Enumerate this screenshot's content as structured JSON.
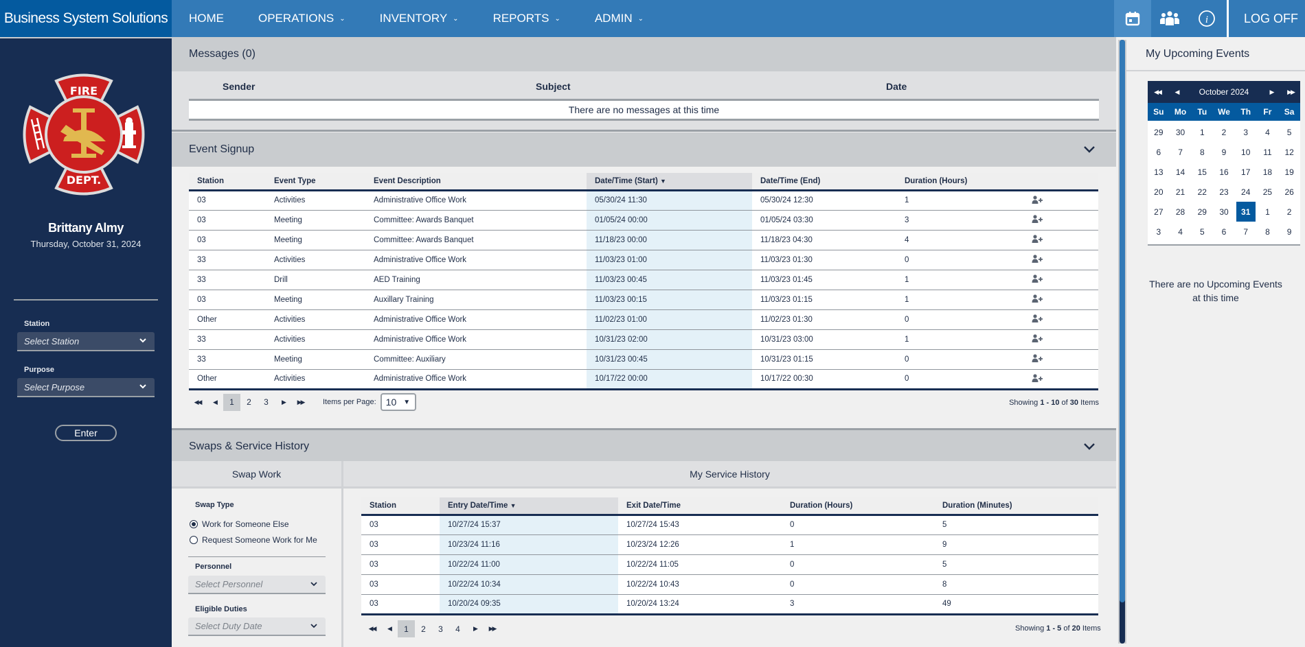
{
  "header": {
    "brand": "Business System Solutions",
    "nav": [
      {
        "label": "HOME",
        "dropdown": false
      },
      {
        "label": "OPERATIONS",
        "dropdown": true
      },
      {
        "label": "INVENTORY",
        "dropdown": true
      },
      {
        "label": "REPORTS",
        "dropdown": true
      },
      {
        "label": "ADMIN",
        "dropdown": true
      }
    ],
    "icons": [
      "calendar-icon",
      "group-icon",
      "info-icon"
    ],
    "logoff_label": "LOG OFF"
  },
  "sidebar": {
    "logo_top_text": "FIRE",
    "logo_bottom_text": "DEPT.",
    "user_name": "Brittany Almy",
    "date": "Thursday, October 31, 2024",
    "station_label": "Station",
    "station_placeholder": "Select Station",
    "purpose_label": "Purpose",
    "purpose_placeholder": "Select Purpose",
    "enter_label": "Enter"
  },
  "messages": {
    "title": "Messages (0)",
    "columns": [
      "Sender",
      "Subject",
      "Date"
    ],
    "empty_text": "There are no messages at this time"
  },
  "event_signup": {
    "title": "Event Signup",
    "columns": [
      "Station",
      "Event Type",
      "Event Description",
      "Date/Time (Start)",
      "Date/Time (End)",
      "Duration (Hours)"
    ],
    "sort_indicator": "▼",
    "rows": [
      {
        "station": "03",
        "type": "Activities",
        "description": "Administrative Office Work",
        "start": "05/30/24 11:30",
        "end": "05/30/24 12:30",
        "duration": "1"
      },
      {
        "station": "03",
        "type": "Meeting",
        "description": "Committee: Awards Banquet",
        "start": "01/05/24 00:00",
        "end": "01/05/24 03:30",
        "duration": "3"
      },
      {
        "station": "03",
        "type": "Meeting",
        "description": "Committee: Awards Banquet",
        "start": "11/18/23 00:00",
        "end": "11/18/23 04:30",
        "duration": "4"
      },
      {
        "station": "33",
        "type": "Activities",
        "description": "Administrative Office Work",
        "start": "11/03/23 01:00",
        "end": "11/03/23 01:30",
        "duration": "0"
      },
      {
        "station": "33",
        "type": "Drill",
        "description": "AED Training",
        "start": "11/03/23 00:45",
        "end": "11/03/23 01:45",
        "duration": "1"
      },
      {
        "station": "03",
        "type": "Meeting",
        "description": "Auxillary Training",
        "start": "11/03/23 00:15",
        "end": "11/03/23 01:15",
        "duration": "1"
      },
      {
        "station": "Other",
        "type": "Activities",
        "description": "Administrative Office Work",
        "start": "11/02/23 01:00",
        "end": "11/02/23 01:30",
        "duration": "0"
      },
      {
        "station": "33",
        "type": "Activities",
        "description": "Administrative Office Work",
        "start": "10/31/23 02:00",
        "end": "10/31/23 03:00",
        "duration": "1"
      },
      {
        "station": "33",
        "type": "Meeting",
        "description": "Committee: Auxiliary",
        "start": "10/31/23 00:45",
        "end": "10/31/23 01:15",
        "duration": "0"
      },
      {
        "station": "Other",
        "type": "Activities",
        "description": "Administrative Office Work",
        "start": "10/17/22 00:00",
        "end": "10/17/22 00:30",
        "duration": "0"
      }
    ],
    "pages": [
      "1",
      "2",
      "3"
    ],
    "current_page": "1",
    "items_per_page_label": "Items per Page:",
    "items_per_page": "10",
    "showing": {
      "prefix": "Showing",
      "range": "1 - 10",
      "of": "of",
      "total": "30",
      "suffix": "Items"
    }
  },
  "swaps": {
    "title": "Swaps & Service History",
    "swap_work": {
      "title": "Swap Work",
      "swap_type_label": "Swap Type",
      "options": [
        {
          "label": "Work for Someone Else",
          "selected": true
        },
        {
          "label": "Request Someone Work for Me",
          "selected": false
        }
      ],
      "personnel_label": "Personnel",
      "personnel_placeholder": "Select Personnel",
      "duties_label": "Eligible Duties",
      "duties_placeholder": "Select Duty Date"
    },
    "service_history": {
      "title": "My Service History",
      "columns": [
        "Station",
        "Entry Date/Time",
        "Exit Date/Time",
        "Duration (Hours)",
        "Duration (Minutes)"
      ],
      "rows": [
        {
          "station": "03",
          "entry": "10/27/24 15:37",
          "exit": "10/27/24 15:43",
          "hours": "0",
          "minutes": "5"
        },
        {
          "station": "03",
          "entry": "10/23/24 11:16",
          "exit": "10/23/24 12:26",
          "hours": "1",
          "minutes": "9"
        },
        {
          "station": "03",
          "entry": "10/22/24 11:00",
          "exit": "10/22/24 11:05",
          "hours": "0",
          "minutes": "5"
        },
        {
          "station": "03",
          "entry": "10/22/24 10:34",
          "exit": "10/22/24 10:43",
          "hours": "0",
          "minutes": "8"
        },
        {
          "station": "03",
          "entry": "10/20/24 09:35",
          "exit": "10/20/24 13:24",
          "hours": "3",
          "minutes": "49"
        }
      ],
      "pages": [
        "1",
        "2",
        "3",
        "4"
      ],
      "current_page": "1",
      "showing": {
        "prefix": "Showing",
        "range": "1 - 5",
        "of": "of",
        "total": "20",
        "suffix": "Items"
      }
    }
  },
  "upcoming": {
    "title": "My Upcoming Events",
    "calendar": {
      "month_label": "October 2024",
      "dow": [
        "Su",
        "Mo",
        "Tu",
        "We",
        "Th",
        "Fr",
        "Sa"
      ],
      "days": [
        "29",
        "30",
        "1",
        "2",
        "3",
        "4",
        "5",
        "6",
        "7",
        "8",
        "9",
        "10",
        "11",
        "12",
        "13",
        "14",
        "15",
        "16",
        "17",
        "18",
        "19",
        "20",
        "21",
        "22",
        "23",
        "24",
        "25",
        "26",
        "27",
        "28",
        "29",
        "30",
        "31",
        "1",
        "2",
        "3",
        "4",
        "5",
        "6",
        "7",
        "8",
        "9"
      ],
      "selected_day": "31"
    },
    "empty_text_line1": "There are no Upcoming Events",
    "empty_text_line2": "at this time"
  },
  "colors": {
    "topbar": "#337ab7",
    "brand": "#045a9f",
    "sidebar": "#172d52",
    "sorted_column": "#e4f1f8",
    "section_header": "#c9cccf"
  }
}
